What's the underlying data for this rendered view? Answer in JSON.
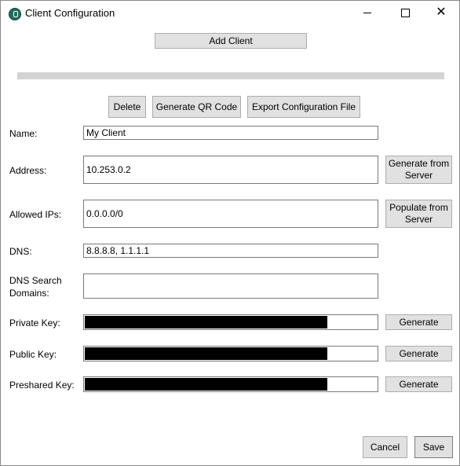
{
  "window": {
    "title": "Client Configuration",
    "icon": "wireguard-app-icon"
  },
  "toolbar": {
    "add_client": "Add Client",
    "delete": "Delete",
    "generate_qr": "Generate QR Code",
    "export": "Export Configuration File"
  },
  "progress": {
    "value": 0
  },
  "form": {
    "name": {
      "label": "Name:",
      "value": "My Client"
    },
    "address": {
      "label": "Address:",
      "value": "10.253.0.2",
      "action": "Generate from Server"
    },
    "allowed_ips": {
      "label": "Allowed IPs:",
      "value": "0.0.0.0/0",
      "action": "Populate from Server"
    },
    "dns": {
      "label": "DNS:",
      "value": "8.8.8.8, 1.1.1.1"
    },
    "dns_search": {
      "label": "DNS Search Domains:",
      "value": ""
    },
    "private_key": {
      "label": "Private Key:",
      "masked_fraction": 0.827,
      "action": "Generate"
    },
    "public_key": {
      "label": "Public Key:",
      "masked_fraction": 0.827,
      "action": "Generate"
    },
    "preshared_key": {
      "label": "Preshared Key:",
      "masked_fraction": 0.827,
      "action": "Generate"
    }
  },
  "footer": {
    "cancel": "Cancel",
    "save": "Save"
  }
}
